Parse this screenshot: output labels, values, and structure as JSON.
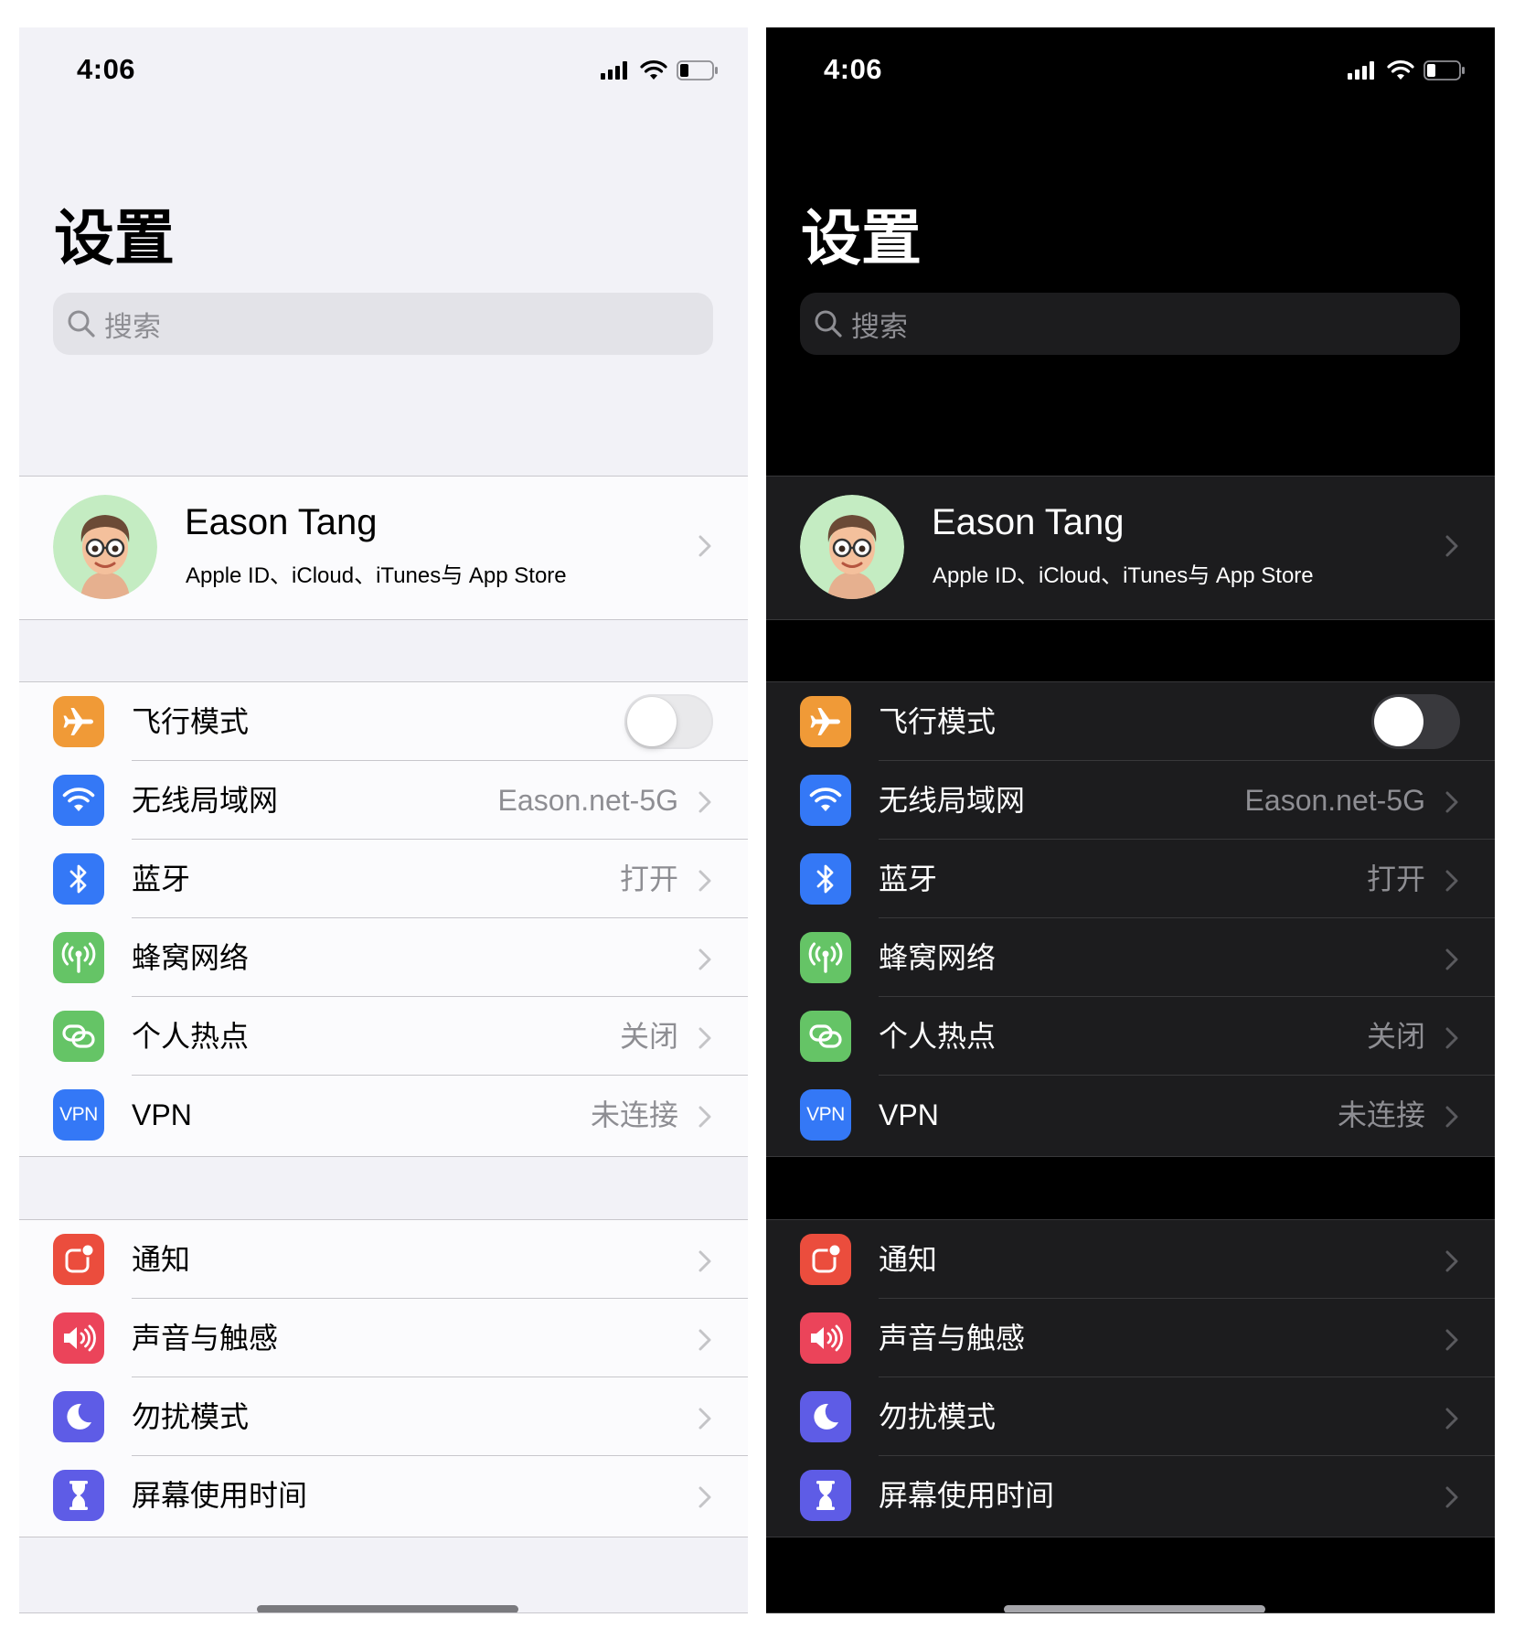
{
  "status_bar": {
    "time": "4:06"
  },
  "title": "设置",
  "search": {
    "placeholder": "搜索"
  },
  "profile": {
    "name": "Eason Tang",
    "subtitle": "Apple ID、iCloud、iTunes与 App Store"
  },
  "network_group": [
    {
      "label": "飞行模式",
      "icon": "airplane-icon",
      "icon_color": "#f09a37",
      "toggle": false
    },
    {
      "label": "无线局域网",
      "value": "Eason.net-5G",
      "icon": "wifi-icon",
      "icon_color": "#3478f6"
    },
    {
      "label": "蓝牙",
      "value": "打开",
      "icon": "bluetooth-icon",
      "icon_color": "#3478f6"
    },
    {
      "label": "蜂窝网络",
      "icon": "cellular-antenna-icon",
      "icon_color": "#65c466"
    },
    {
      "label": "个人热点",
      "value": "关闭",
      "icon": "hotspot-link-icon",
      "icon_color": "#65c466"
    },
    {
      "label": "VPN",
      "value": "未连接",
      "icon": "vpn-icon",
      "icon_text": "VPN",
      "icon_color": "#3478f6"
    }
  ],
  "system_group": [
    {
      "label": "通知",
      "icon": "notification-icon",
      "icon_color": "#eb4d3d"
    },
    {
      "label": "声音与触感",
      "icon": "speaker-icon",
      "icon_color": "#eb445a"
    },
    {
      "label": "勿扰模式",
      "icon": "moon-icon",
      "icon_color": "#5e5ce6"
    },
    {
      "label": "屏幕使用时间",
      "icon": "hourglass-icon",
      "icon_color": "#5e5ce6"
    }
  ],
  "themes": {
    "light_background": "#f2f2f7",
    "dark_background": "#000000"
  }
}
